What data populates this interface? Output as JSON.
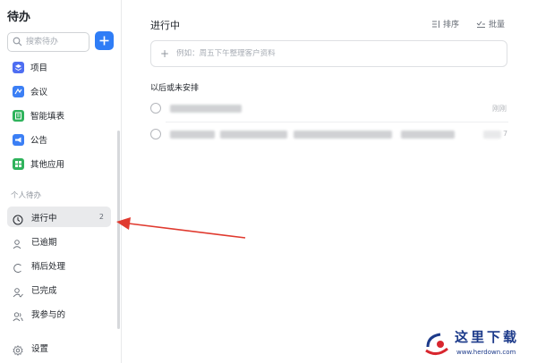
{
  "sidebar": {
    "title": "待办",
    "search_placeholder": "搜索待办",
    "apps": [
      {
        "label": "项目",
        "icon": "project-icon",
        "color": "#4e6ef2"
      },
      {
        "label": "会议",
        "icon": "meeting-icon",
        "color": "#3b7ff5"
      },
      {
        "label": "智能填表",
        "icon": "form-icon",
        "color": "#2fb35c"
      },
      {
        "label": "公告",
        "icon": "announcement-icon",
        "color": "#3b7ff5"
      },
      {
        "label": "其他应用",
        "icon": "apps-grid-icon",
        "color": "#2fb35c"
      }
    ],
    "section_label": "个人待办",
    "personal": [
      {
        "label": "进行中",
        "count": "2",
        "icon": "clock-icon"
      },
      {
        "label": "已逾期",
        "icon": "user-overdue-icon"
      },
      {
        "label": "稍后处理",
        "icon": "later-icon"
      },
      {
        "label": "已完成",
        "icon": "user-done-icon"
      },
      {
        "label": "我参与的",
        "icon": "participants-icon"
      }
    ],
    "settings_label": "设置"
  },
  "main": {
    "title": "进行中",
    "sort_label": "排序",
    "batch_label": "批量",
    "add_placeholder": "例如：周五下午整理客户资料",
    "group_label": "以后或未安排",
    "tasks": [
      {
        "right_text": "刚刚"
      },
      {
        "right_text": "7"
      }
    ]
  },
  "watermark": {
    "title": "这里下载",
    "url": "www.herdown.com"
  },
  "colors": {
    "accent": "#2f7df6",
    "annotation_arrow": "#e03a2f"
  }
}
